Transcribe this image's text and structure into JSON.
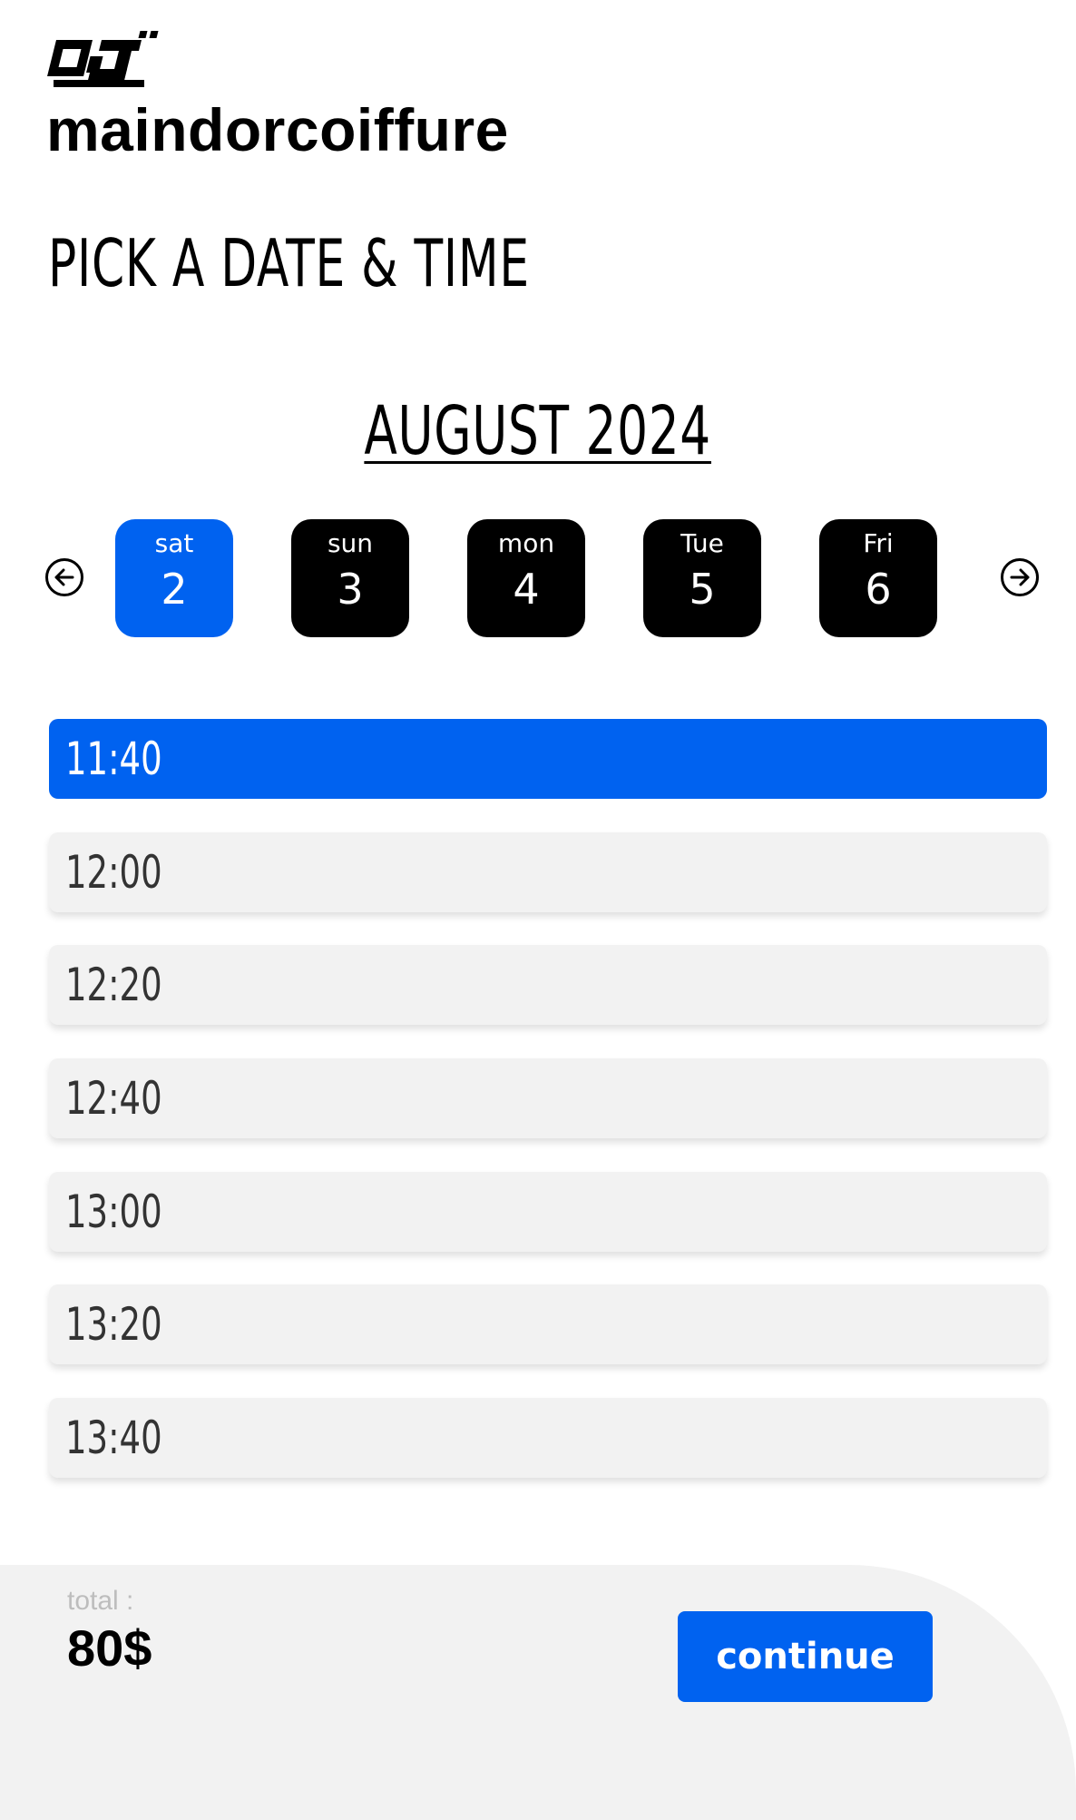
{
  "brand": {
    "name": "maindorcoiffure"
  },
  "page": {
    "title": "PICK A DATE & TIME"
  },
  "calendar": {
    "month_label": "AUGUST 2024",
    "prev_icon": "arrow-left-circle-icon",
    "next_icon": "arrow-right-circle-icon",
    "days": [
      {
        "dow": "sat",
        "num": "2",
        "selected": true
      },
      {
        "dow": "sun",
        "num": "3",
        "selected": false
      },
      {
        "dow": "mon",
        "num": "4",
        "selected": false
      },
      {
        "dow": "Tue",
        "num": "5",
        "selected": false
      },
      {
        "dow": "Fri",
        "num": "6",
        "selected": false
      }
    ]
  },
  "time_slots": [
    {
      "time": "11:40",
      "selected": true
    },
    {
      "time": "12:00",
      "selected": false
    },
    {
      "time": "12:20",
      "selected": false
    },
    {
      "time": "12:40",
      "selected": false
    },
    {
      "time": "13:00",
      "selected": false
    },
    {
      "time": "13:20",
      "selected": false
    },
    {
      "time": "13:40",
      "selected": false
    }
  ],
  "footer": {
    "total_label": "total :",
    "total_value": "80$",
    "continue_label": "continue"
  },
  "colors": {
    "accent": "#0062f0",
    "day_default": "#000000",
    "slot_background": "#f2f2f2",
    "footer_background": "#f2f2f2"
  }
}
